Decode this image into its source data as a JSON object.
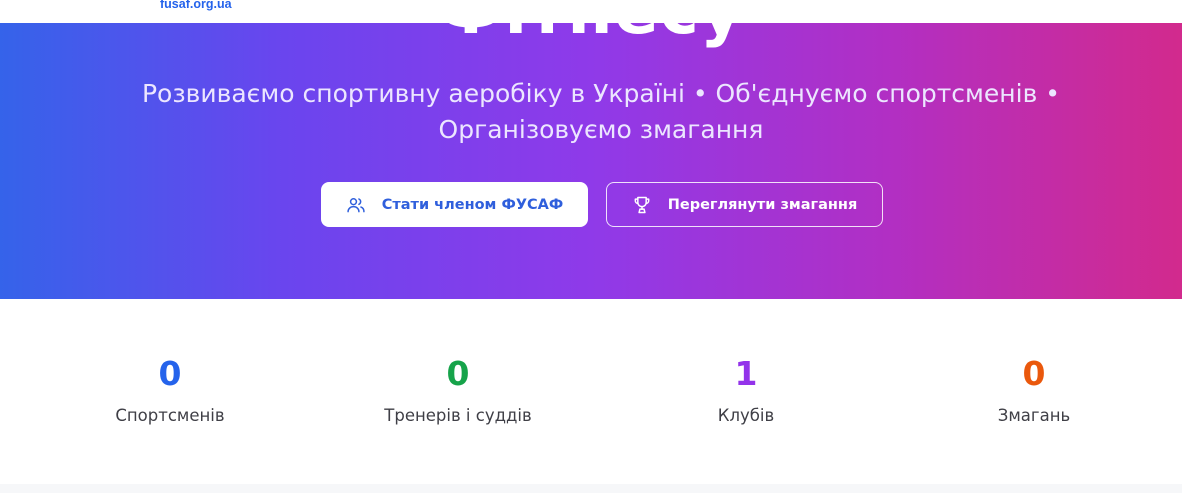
{
  "header": {
    "site_url": "fusaf.org.ua"
  },
  "hero": {
    "title": "Фітнесу",
    "subtitle": "Розвиваємо спортивну аеробіку в Україні • Об'єднуємо спортсменів • Організовуємо змагання",
    "primary_button": {
      "label": "Стати членом ФУСАФ",
      "icon": "users-icon"
    },
    "secondary_button": {
      "label": "Переглянути змагання",
      "icon": "trophy-icon"
    },
    "gradient_colors": [
      "#3563ea",
      "#8f3ae9",
      "#d22a8d"
    ]
  },
  "stats": [
    {
      "value": "0",
      "label": "Спортсменів",
      "color": "#2563eb"
    },
    {
      "value": "0",
      "label": "Тренерів і суддів",
      "color": "#16a34a"
    },
    {
      "value": "1",
      "label": "Клубів",
      "color": "#9333ea"
    },
    {
      "value": "0",
      "label": "Змагань",
      "color": "#ea580c"
    }
  ]
}
